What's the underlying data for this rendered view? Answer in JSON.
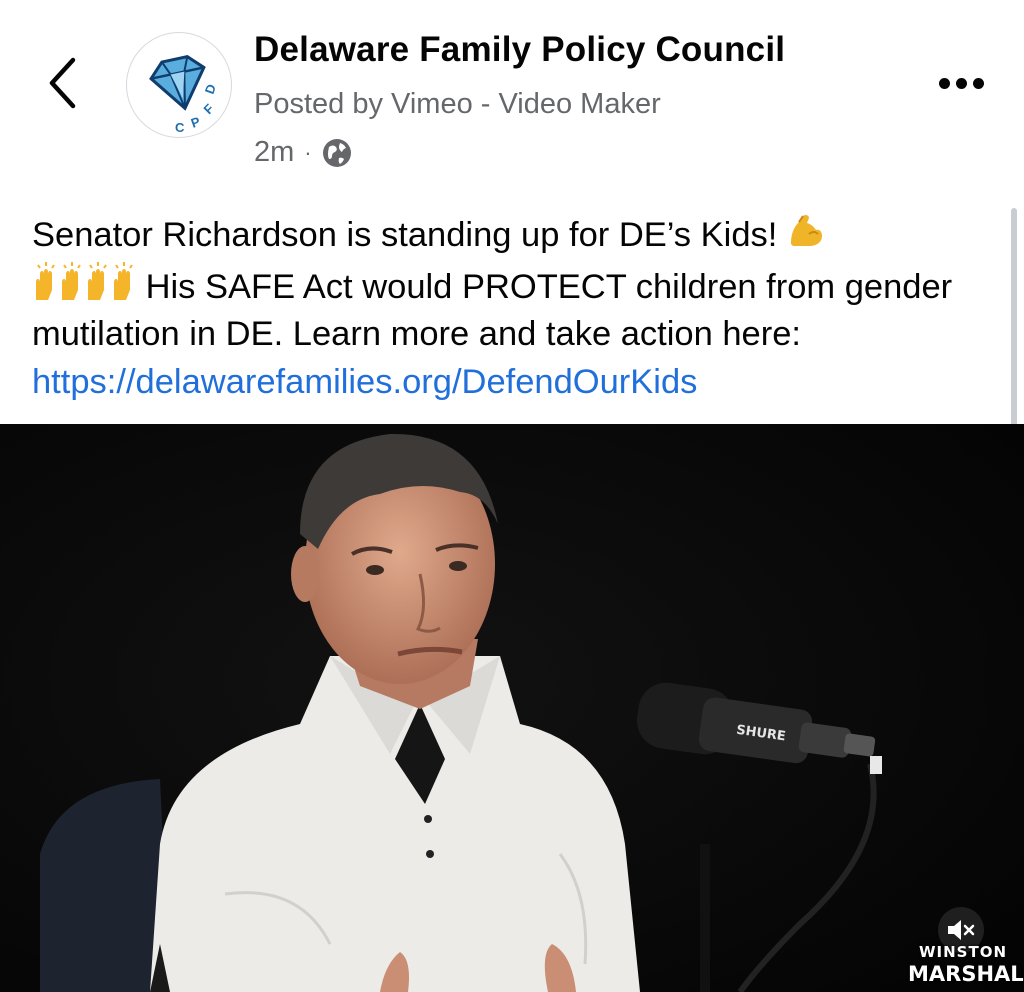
{
  "header": {
    "page_name": "Delaware Family Policy Council",
    "posted_by": "Posted by Vimeo - Video Maker",
    "time": "2m",
    "separator": "·",
    "avatar_logo_text": "DFPC",
    "icons": [
      "back-chevron-icon",
      "globe-icon",
      "more-icon"
    ]
  },
  "post": {
    "line1": "Senator Richardson is standing up for DE’s Kids! ",
    "line2": " His SAFE Act would PROTECT children from gender mutilation in DE. Learn more and take action here: ",
    "link": "https://delawarefamilies.org/DefendOurKids",
    "emojis": [
      "flexed-biceps-emoji",
      "raising-hands-emoji",
      "raising-hands-emoji"
    ]
  },
  "video": {
    "mic_brand": "SHURE",
    "watermark_top": "WINSTON",
    "watermark_bottom": "MARSHALL",
    "sound": "muted",
    "icons": [
      "speaker-muted-icon"
    ]
  },
  "colors": {
    "link": "#216fdb",
    "secondary_text": "#65676b",
    "logo_blue": "#1f8fd0",
    "video_bg": "#050505"
  }
}
